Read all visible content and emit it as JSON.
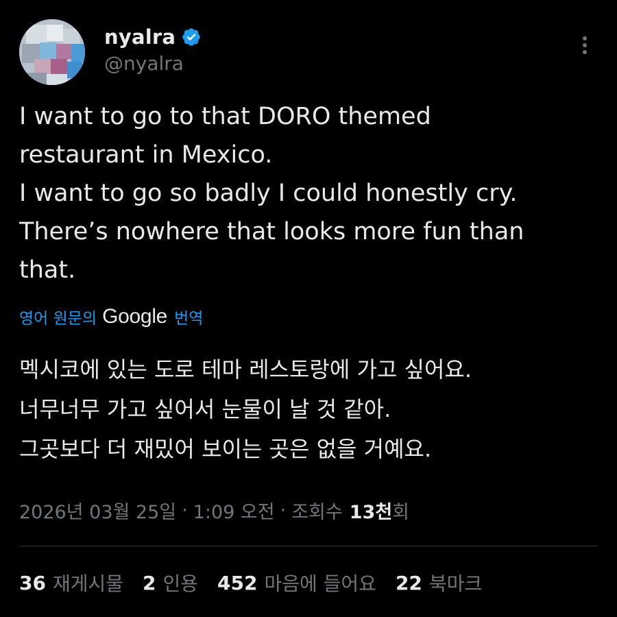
{
  "author": {
    "display_name": "nyalra",
    "handle": "@nyalra",
    "verified": true
  },
  "tweet": {
    "text_lines": [
      "I want to go to that DORO themed",
      "restaurant in Mexico.",
      "I want to go so badly I could honestly cry.",
      "There’s nowhere that looks more fun than",
      "that."
    ],
    "translate": {
      "prefix": "영어 원문의",
      "brand": "Google",
      "suffix": "번역"
    },
    "translated_lines": [
      "멕시코에 있는 도로 테마 레스토랑에 가고 싶어요.",
      "너무너무 가고 싶어서 눈물이 날 것 같아.",
      "그곳보다 더 재밌어 보이는 곳은 없을 거예요."
    ]
  },
  "meta": {
    "date": "2026년 03월 25일",
    "separator": "·",
    "time": "1:09 오전",
    "views_label": "조회수",
    "views_count": "13천",
    "views_suffix": "회"
  },
  "stats": {
    "reposts": {
      "count": "36",
      "label": "재게시물"
    },
    "quotes": {
      "count": "2",
      "label": "인용"
    },
    "likes": {
      "count": "452",
      "label": "마음에 들어요"
    },
    "bookmarks": {
      "count": "22",
      "label": "북마크"
    }
  },
  "colors": {
    "background": "#000000",
    "text": "#e7e9ea",
    "secondary": "#71767b",
    "accent": "#1d9bf0",
    "divider": "#2f3336"
  },
  "icons": {
    "verified": "verified-badge-icon",
    "more": "more-vertical-icon"
  }
}
